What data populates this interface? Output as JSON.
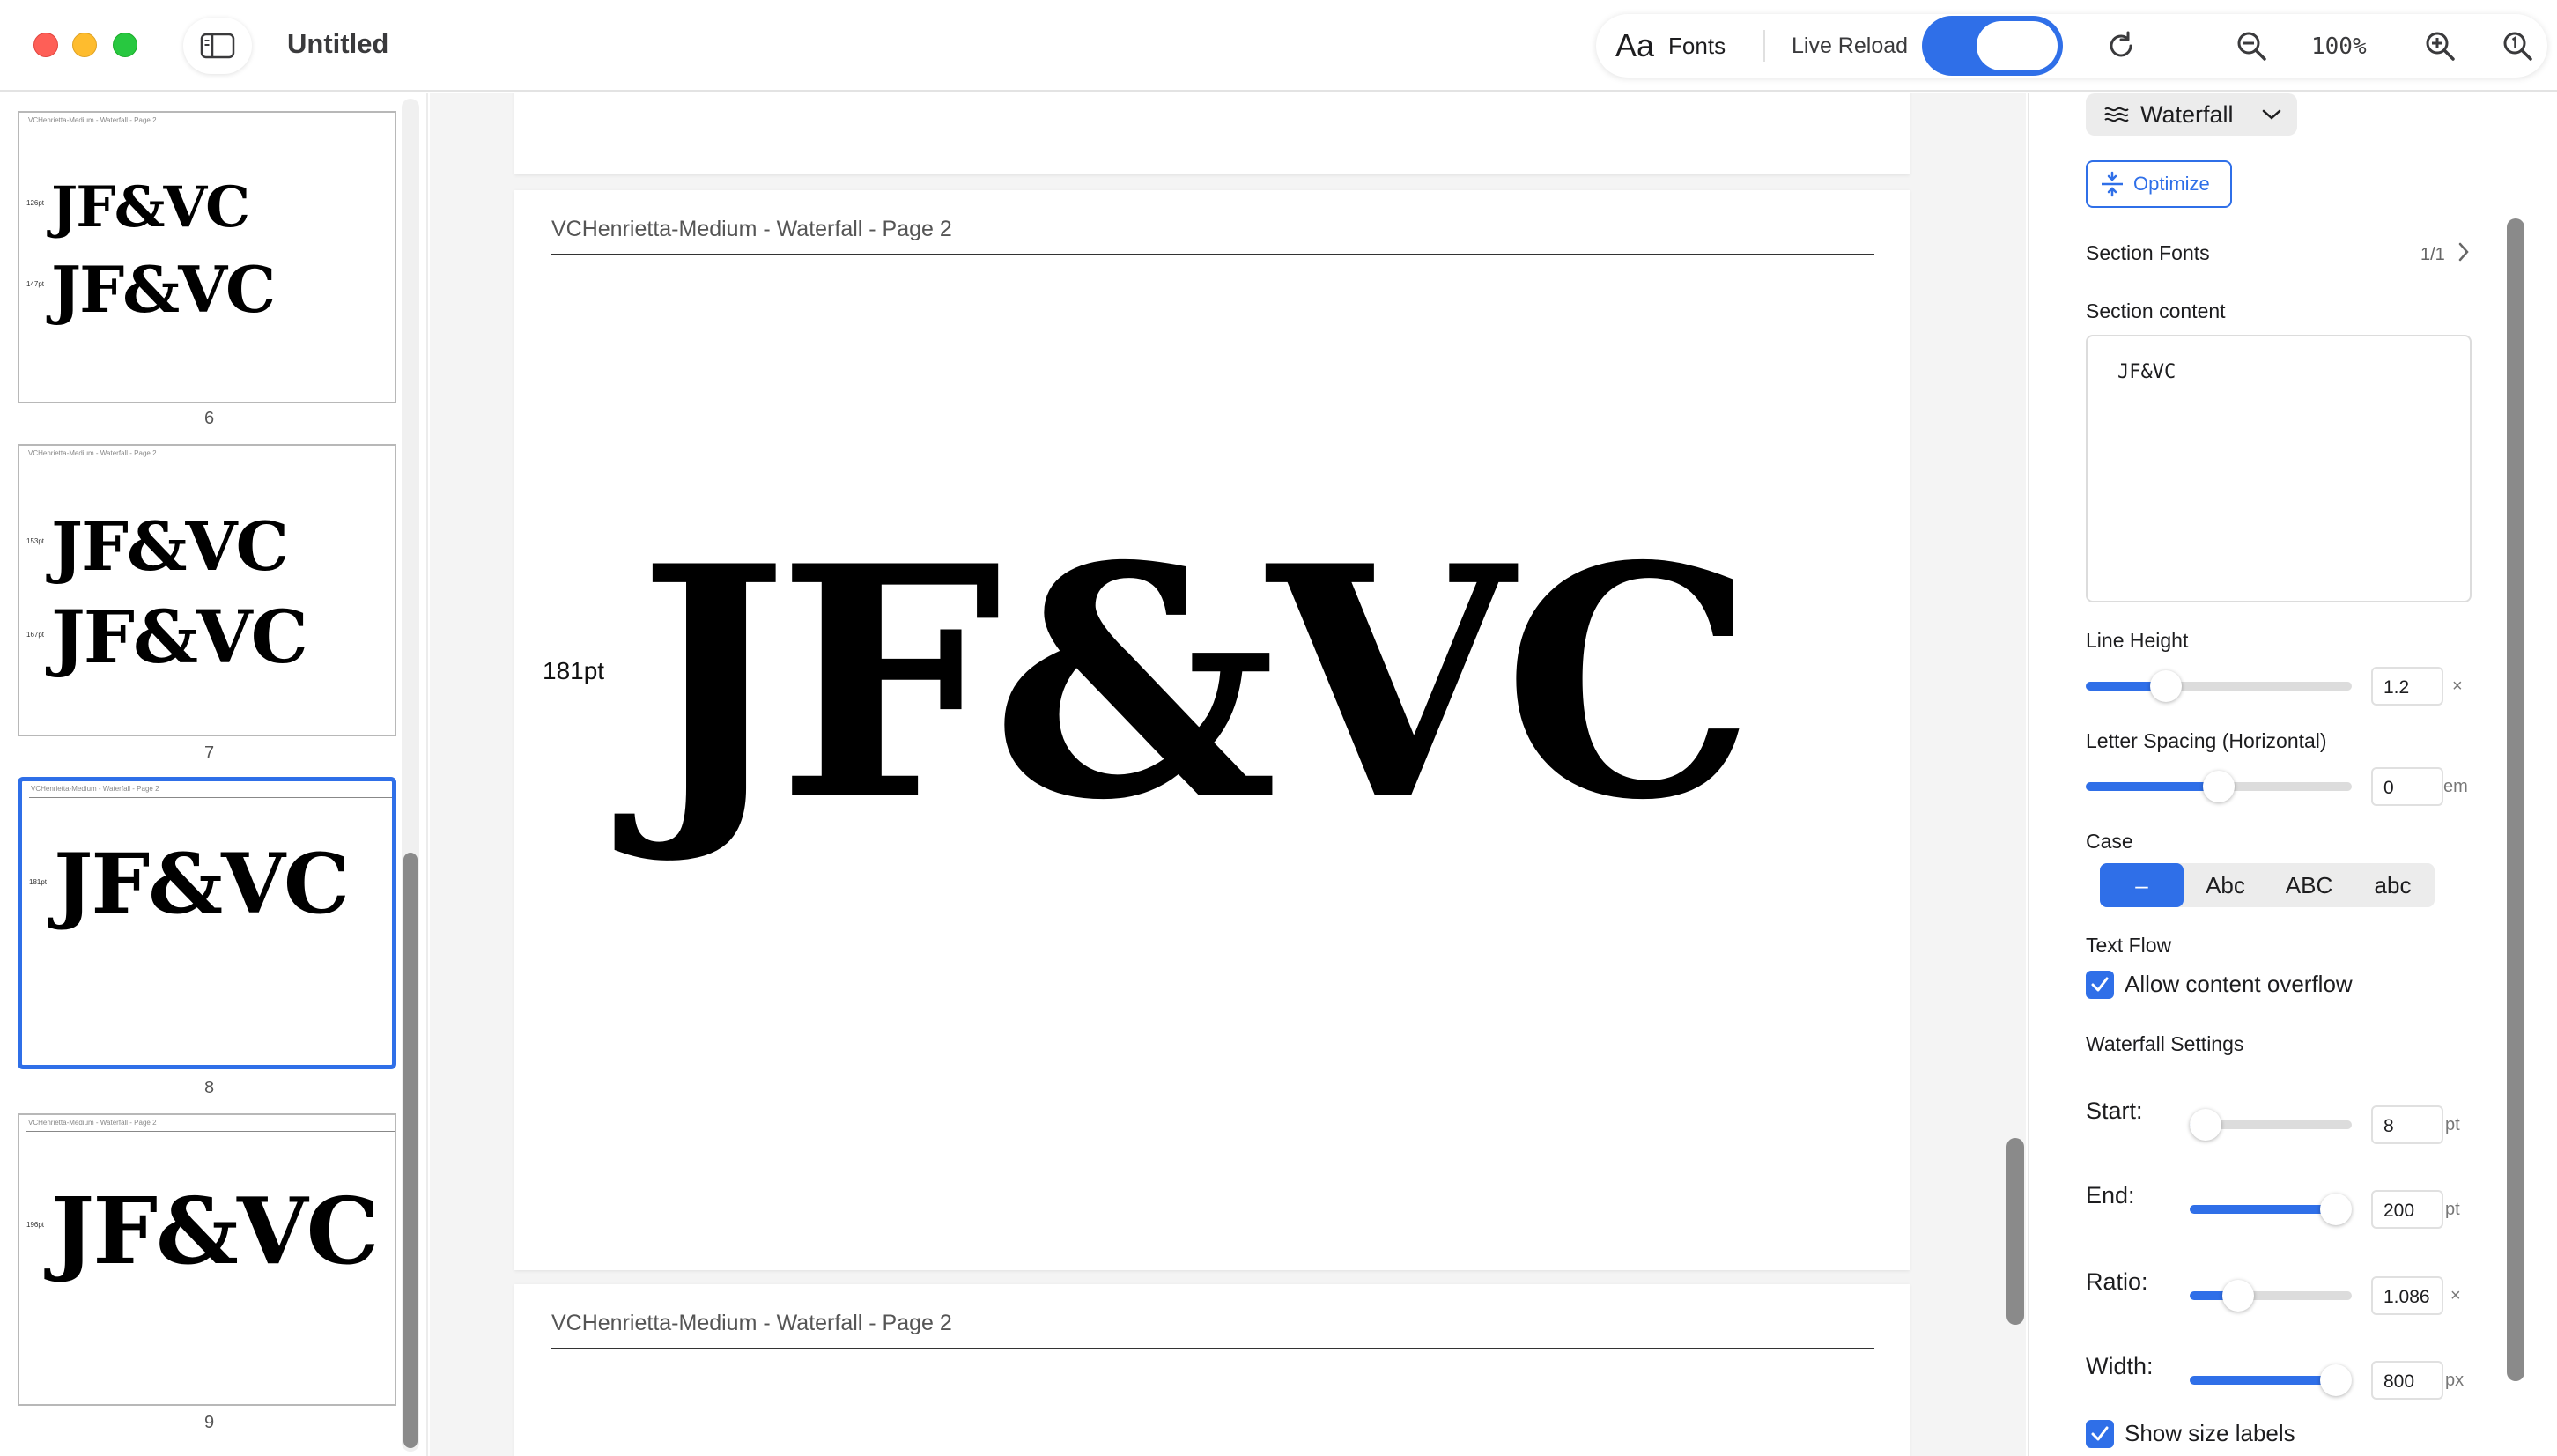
{
  "window": {
    "title": "Untitled"
  },
  "toolbar": {
    "fonts_glyph": "Aa",
    "fonts_label": "Fonts",
    "live_reload_label": "Live Reload",
    "live_reload_on": true,
    "zoom_level": "100%"
  },
  "thumbnails": [
    {
      "number": "6",
      "header": "VCHenrietta-Medium - Waterfall - Page 2",
      "lines": [
        {
          "size": "126pt",
          "text": "JF&VC"
        },
        {
          "size": "147pt",
          "text": "JF&VC"
        }
      ]
    },
    {
      "number": "7",
      "header": "VCHenrietta-Medium - Waterfall - Page 2",
      "lines": [
        {
          "size": "153pt",
          "text": "JF&VC"
        },
        {
          "size": "167pt",
          "text": "JF&VC"
        }
      ]
    },
    {
      "number": "8",
      "header": "VCHenrietta-Medium - Waterfall - Page 2",
      "selected": true,
      "lines": [
        {
          "size": "181pt",
          "text": "JF&VC"
        }
      ]
    },
    {
      "number": "9",
      "header": "VCHenrietta-Medium - Waterfall - Page 2",
      "lines": [
        {
          "size": "196pt",
          "text": "JF&VC"
        }
      ]
    }
  ],
  "canvas": {
    "pages": [
      {
        "header": "VCHenrietta-Medium - Waterfall - Page 2",
        "size_label": "181pt",
        "sample": "JF&VC"
      },
      {
        "header": "VCHenrietta-Medium - Waterfall - Page 2"
      }
    ]
  },
  "inspector": {
    "mode": "Waterfall",
    "optimize_label": "Optimize",
    "section_fonts_label": "Section Fonts",
    "section_fonts_count": "1/1",
    "section_content_label": "Section content",
    "section_content_value": "JF&VC",
    "line_height": {
      "label": "Line Height",
      "value": "1.2",
      "unit": "×",
      "fraction": 0.3
    },
    "letter_spacing": {
      "label": "Letter Spacing (Horizontal)",
      "value": "0",
      "unit": "em",
      "fraction": 0.5
    },
    "case": {
      "label": "Case",
      "options": [
        "–",
        "Abc",
        "ABC",
        "abc"
      ],
      "selected": 0
    },
    "text_flow": {
      "label": "Text Flow",
      "overflow_label": "Allow content overflow",
      "overflow_checked": true
    },
    "waterfall": {
      "label": "Waterfall Settings",
      "start": {
        "label": "Start:",
        "value": "8",
        "unit": "pt",
        "fraction": 0.1
      },
      "end": {
        "label": "End:",
        "value": "200",
        "unit": "pt",
        "fraction": 0.9
      },
      "ratio": {
        "label": "Ratio:",
        "value": "1.086",
        "unit": "×",
        "fraction": 0.3
      },
      "width": {
        "label": "Width:",
        "value": "800",
        "unit": "px",
        "fraction": 0.9
      }
    },
    "show_size_labels": {
      "label": "Show size labels",
      "checked": true
    }
  },
  "colors": {
    "accent": "#2f6fe8",
    "traffic_red": "#fe5f57",
    "traffic_yellow": "#febc2e",
    "traffic_green": "#28c840"
  }
}
